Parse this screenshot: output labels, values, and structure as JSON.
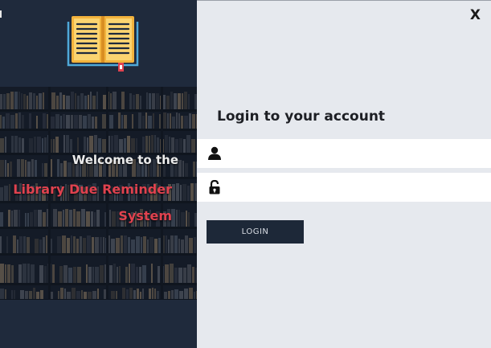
{
  "window": {
    "close_label": "X"
  },
  "branding": {
    "welcome": "Welcome to the",
    "title_line1": "Library Due Reminder",
    "title_line2": "System",
    "logo_icon": "open-book-icon"
  },
  "login": {
    "heading": "Login to your account",
    "username": {
      "value": "",
      "placeholder": "",
      "icon": "user-icon"
    },
    "password": {
      "value": "",
      "placeholder": "",
      "icon": "unlocked-padlock-icon"
    },
    "button_label": "LOGIN"
  },
  "colors": {
    "left_panel_bg": "#1f2a3c",
    "right_panel_bg": "#e6e9ee",
    "title_accent": "#e0424f",
    "button_bg": "#1d2838",
    "logo_accent": "#f2b33d"
  }
}
